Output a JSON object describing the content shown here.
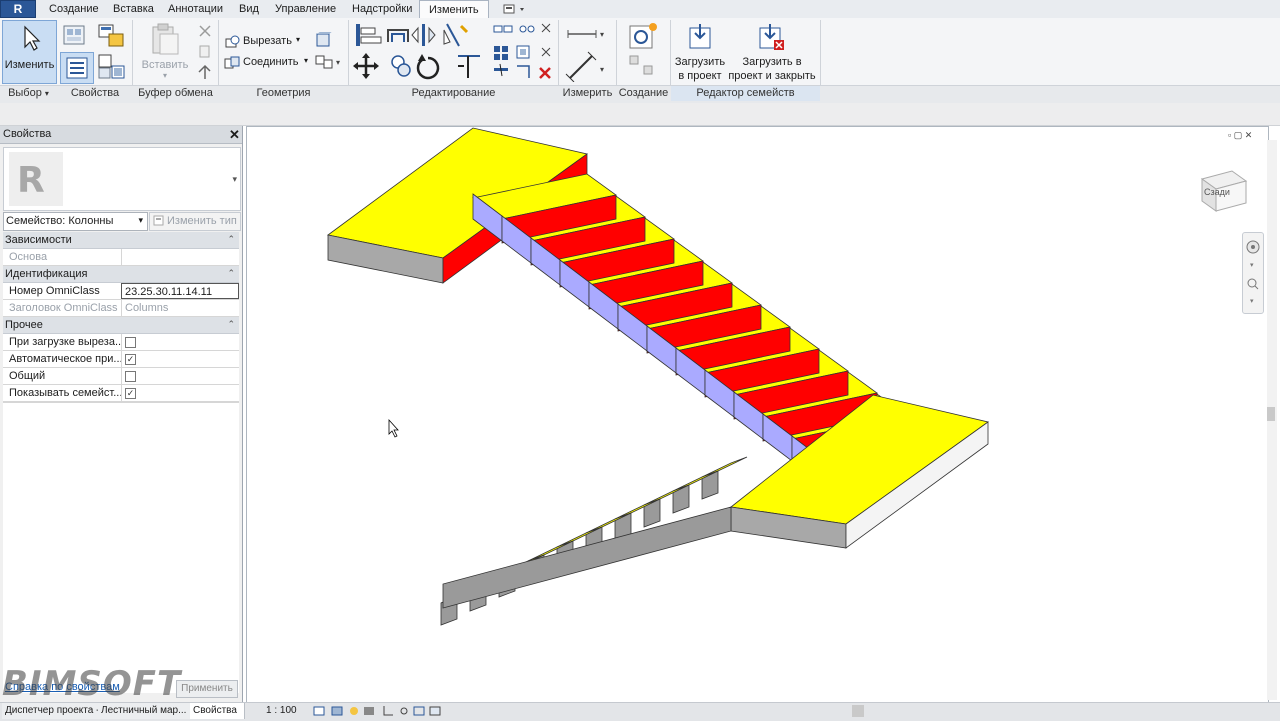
{
  "menu": {
    "tabs": [
      "Создание",
      "Вставка",
      "Аннотации",
      "Вид",
      "Управление",
      "Надстройки",
      "Изменить"
    ],
    "active_tab": "Изменить"
  },
  "ribbon": {
    "modify_label": "Изменить",
    "cut_label": "Вырезать",
    "join_label": "Соединить",
    "paste_label": "Вставить",
    "load_into_project": [
      "Загрузить",
      "в проект"
    ],
    "load_and_close": [
      "Загрузить в",
      "проект и закрыть"
    ],
    "panels": {
      "select": "Выбор",
      "properties": "Свойства",
      "clipboard": "Буфер обмена",
      "geometry": "Геометрия",
      "modify": "Редактирование",
      "measure": "Измерить",
      "create": "Создание",
      "family_editor": "Редактор семейств"
    }
  },
  "properties": {
    "title": "Свойства",
    "type_selector": "Семейство: Колонны",
    "edit_type": "Изменить тип",
    "groups": {
      "constraints": "Зависимости",
      "identity": "Идентификация",
      "other": "Прочее"
    },
    "rows": {
      "host": "Основа",
      "omniclass_number_label": "Номер OmniClass",
      "omniclass_number_value": "23.25.30.11.14.11",
      "omniclass_title_label": "Заголовок OmniClass",
      "omniclass_title_value": "Columns",
      "cut_on_load": "При загрузке выреза...",
      "auto_place": "Автоматическое при...",
      "shared": "Общий",
      "show_family": "Показывать семейст..."
    },
    "checks": {
      "cut_on_load": false,
      "auto_place": true,
      "shared": false,
      "show_family": true
    },
    "help_link": "Справка по свойствам",
    "apply_button": "Применить"
  },
  "viewcube": {
    "face": "Сзади"
  },
  "status": {
    "tabs": [
      "Диспетчер проекта -...",
      "Лестничный мар...",
      "Свойства"
    ],
    "scale": "1 : 100"
  },
  "watermark": "BIMSOFT",
  "colors": {
    "tread": "#ffff00",
    "riser": "#ff0000",
    "soffit": "#aaaaff",
    "side": "#9a9a9a",
    "accent": "#2b5797"
  }
}
